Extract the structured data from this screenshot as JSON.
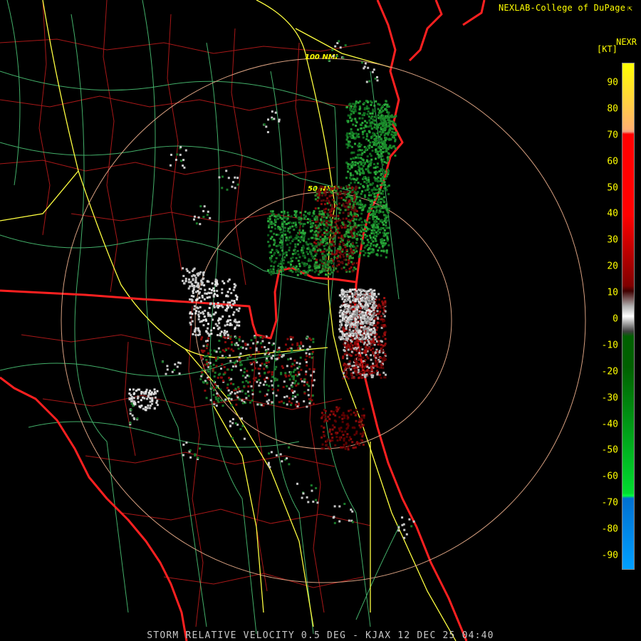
{
  "header": {
    "credit": "NEXLAB-College of DuPage",
    "credit_icon": "external-link-icon",
    "product": "NEXR",
    "units": "[KT]"
  },
  "legend": {
    "ticks": [
      "90",
      "80",
      "70",
      "60",
      "50",
      "40",
      "30",
      "20",
      "10",
      "0",
      "-10",
      "-20",
      "-30",
      "-40",
      "-50",
      "-60",
      "-70",
      "-80",
      "-90"
    ],
    "colors": {
      "pos_high": "#ffff00",
      "pos_mid": "#ff0000",
      "pos_low": "#800000",
      "zero": "#b0b0b0",
      "neg_low": "#006000",
      "neg_mid": "#00dd30",
      "neg_high": "#0070d0"
    }
  },
  "map": {
    "range_rings": [
      {
        "label": "100 NMI"
      },
      {
        "label": "50 NMI"
      }
    ],
    "colors": {
      "state_border": "#ff2020",
      "county_border": "#b01818",
      "highway": "#ffff40",
      "road": "#50d080",
      "range_ring": "#d8a080",
      "background": "#000000"
    }
  },
  "footer": {
    "caption": "STORM RELATIVE VELOCITY 0.5 DEG - KJAX 12 DEC 25 04:40"
  }
}
